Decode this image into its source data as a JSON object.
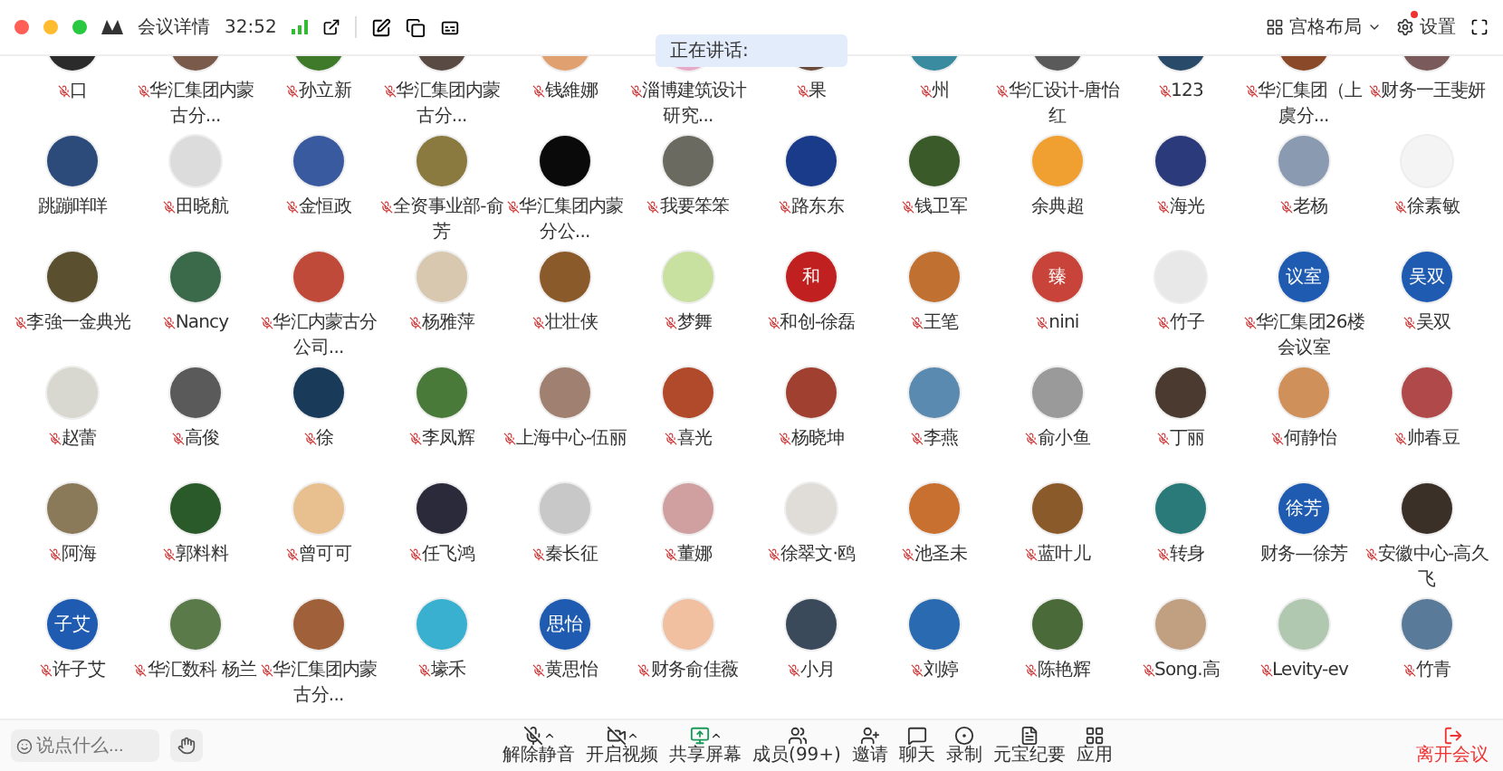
{
  "header": {
    "title": "会议详情",
    "duration": "32:52",
    "layout_label": "宫格布局",
    "settings_label": "设置",
    "settings_badge": true
  },
  "speaking": {
    "label": "正在讲话:"
  },
  "participants": [
    {
      "name": "口",
      "muted": true,
      "avatar": {
        "kind": "photo",
        "color": "#2b2b2b"
      }
    },
    {
      "name": "华汇集团内蒙古分...",
      "muted": true,
      "avatar": {
        "kind": "photo",
        "color": "#7a5a4a"
      }
    },
    {
      "name": "孙立新",
      "muted": true,
      "avatar": {
        "kind": "photo",
        "color": "#3f7a2a"
      }
    },
    {
      "name": "华汇集团内蒙古分...",
      "muted": true,
      "avatar": {
        "kind": "photo",
        "color": "#5a4a44"
      }
    },
    {
      "name": "钱維娜",
      "muted": true,
      "avatar": {
        "kind": "photo",
        "color": "#e0a070"
      }
    },
    {
      "name": "淄博建筑设计研究...",
      "muted": true,
      "avatar": {
        "kind": "photo",
        "color": "#e8a8c8"
      }
    },
    {
      "name": "果",
      "muted": true,
      "avatar": {
        "kind": "photo",
        "color": "#6a4a3a"
      }
    },
    {
      "name": "州",
      "muted": true,
      "avatar": {
        "kind": "photo",
        "color": "#3a8aa0"
      }
    },
    {
      "name": "华汇设计-唐怡红",
      "muted": true,
      "avatar": {
        "kind": "photo",
        "color": "#5a5a5a"
      }
    },
    {
      "name": "123",
      "muted": true,
      "avatar": {
        "kind": "photo",
        "color": "#2a4a6a"
      }
    },
    {
      "name": "华汇集团（上虞分...",
      "muted": true,
      "avatar": {
        "kind": "photo",
        "color": "#8a4a2a"
      }
    },
    {
      "name": "财务一王斐妍",
      "muted": true,
      "avatar": {
        "kind": "photo",
        "color": "#7a5a5a"
      }
    },
    {
      "name": "跳蹦咩咩",
      "muted": false,
      "avatar": {
        "kind": "photo",
        "color": "#2c4a7a"
      }
    },
    {
      "name": "田晓航",
      "muted": true,
      "avatar": {
        "kind": "photo",
        "color": "#dcdcdc"
      }
    },
    {
      "name": "金恒政",
      "muted": true,
      "avatar": {
        "kind": "photo",
        "color": "#3a5aa0"
      }
    },
    {
      "name": "全资事业部-俞芳",
      "muted": true,
      "avatar": {
        "kind": "photo",
        "color": "#8a7a40"
      }
    },
    {
      "name": "华汇集团内蒙分公...",
      "muted": true,
      "avatar": {
        "kind": "photo",
        "color": "#0a0a0a"
      }
    },
    {
      "name": "我要笨笨",
      "muted": true,
      "avatar": {
        "kind": "photo",
        "color": "#6a6a60"
      }
    },
    {
      "name": "路东东",
      "muted": true,
      "avatar": {
        "kind": "photo",
        "color": "#1a3a8a"
      }
    },
    {
      "name": "钱卫军",
      "muted": true,
      "avatar": {
        "kind": "photo",
        "color": "#3a5a2a"
      }
    },
    {
      "name": "余典超",
      "muted": false,
      "avatar": {
        "kind": "photo",
        "color": "#f0a030"
      }
    },
    {
      "name": "海光",
      "muted": true,
      "avatar": {
        "kind": "photo",
        "color": "#2a3a7a"
      }
    },
    {
      "name": "老杨",
      "muted": true,
      "avatar": {
        "kind": "photo",
        "color": "#8a9ab0"
      }
    },
    {
      "name": "徐素敏",
      "muted": true,
      "avatar": {
        "kind": "photo",
        "color": "#f4f4f4"
      }
    },
    {
      "name": "李強一金典光",
      "muted": true,
      "avatar": {
        "kind": "photo",
        "color": "#5a5030"
      }
    },
    {
      "name": "Nancy",
      "muted": true,
      "avatar": {
        "kind": "photo",
        "color": "#3a6a4a"
      }
    },
    {
      "name": "华汇内蒙古分公司...",
      "muted": true,
      "avatar": {
        "kind": "photo",
        "color": "#c04a3a"
      }
    },
    {
      "name": "杨雅萍",
      "muted": true,
      "avatar": {
        "kind": "photo",
        "color": "#d8c8b0"
      }
    },
    {
      "name": "壮壮侠",
      "muted": true,
      "avatar": {
        "kind": "photo",
        "color": "#8a5a2a"
      }
    },
    {
      "name": "梦舞",
      "muted": true,
      "avatar": {
        "kind": "photo",
        "color": "#c8e0a0"
      }
    },
    {
      "name": "和创-徐磊",
      "muted": true,
      "avatar": {
        "kind": "text",
        "text": "和",
        "color": "#c02020"
      }
    },
    {
      "name": "王笔",
      "muted": true,
      "avatar": {
        "kind": "photo",
        "color": "#c07030"
      }
    },
    {
      "name": "nini",
      "muted": true,
      "avatar": {
        "kind": "text",
        "text": "臻",
        "color": "#c8443a"
      }
    },
    {
      "name": "竹子",
      "muted": true,
      "avatar": {
        "kind": "photo",
        "color": "#e8e8e8"
      }
    },
    {
      "name": "华汇集团26楼会议室",
      "muted": true,
      "avatar": {
        "kind": "text",
        "text": "议室",
        "color": "#1f5bb0"
      }
    },
    {
      "name": "吴双",
      "muted": true,
      "avatar": {
        "kind": "text",
        "text": "吴双",
        "color": "#1f5bb0"
      }
    },
    {
      "name": "赵蕾",
      "muted": true,
      "avatar": {
        "kind": "photo",
        "color": "#d8d8d0"
      }
    },
    {
      "name": "高俊",
      "muted": true,
      "avatar": {
        "kind": "photo",
        "color": "#5a5a5a"
      }
    },
    {
      "name": "徐",
      "muted": true,
      "avatar": {
        "kind": "photo",
        "color": "#1a3a5a"
      }
    },
    {
      "name": "李凤辉",
      "muted": true,
      "avatar": {
        "kind": "photo",
        "color": "#4a7a3a"
      }
    },
    {
      "name": "上海中心-伍丽",
      "muted": true,
      "avatar": {
        "kind": "photo",
        "color": "#a08070"
      }
    },
    {
      "name": "喜光",
      "muted": true,
      "avatar": {
        "kind": "photo",
        "color": "#b04a2a"
      }
    },
    {
      "name": "杨晓坤",
      "muted": true,
      "avatar": {
        "kind": "photo",
        "color": "#a04030"
      }
    },
    {
      "name": "李燕",
      "muted": true,
      "avatar": {
        "kind": "photo",
        "color": "#5a8ab0"
      }
    },
    {
      "name": "俞小鱼",
      "muted": true,
      "avatar": {
        "kind": "photo",
        "color": "#9a9a9a"
      }
    },
    {
      "name": "丁丽",
      "muted": true,
      "avatar": {
        "kind": "photo",
        "color": "#4a3a30"
      }
    },
    {
      "name": "何静怡",
      "muted": true,
      "avatar": {
        "kind": "photo",
        "color": "#d0905a"
      }
    },
    {
      "name": "帅春豆",
      "muted": true,
      "avatar": {
        "kind": "photo",
        "color": "#b04a4a"
      }
    },
    {
      "name": "阿海",
      "muted": true,
      "avatar": {
        "kind": "photo",
        "color": "#8a7a5a"
      }
    },
    {
      "name": "郭料料",
      "muted": true,
      "avatar": {
        "kind": "photo",
        "color": "#2a5a2a"
      }
    },
    {
      "name": "曾可可",
      "muted": true,
      "avatar": {
        "kind": "photo",
        "color": "#e8c090"
      }
    },
    {
      "name": "任飞鸿",
      "muted": true,
      "avatar": {
        "kind": "photo",
        "color": "#2a2a3a"
      }
    },
    {
      "name": "秦长征",
      "muted": true,
      "avatar": {
        "kind": "photo",
        "color": "#c8c8c8"
      }
    },
    {
      "name": "董娜",
      "muted": true,
      "avatar": {
        "kind": "photo",
        "color": "#d0a0a0"
      }
    },
    {
      "name": "徐翠文·鸥",
      "muted": true,
      "avatar": {
        "kind": "photo",
        "color": "#e0dcd8"
      }
    },
    {
      "name": "池圣未",
      "muted": true,
      "avatar": {
        "kind": "photo",
        "color": "#c87030"
      }
    },
    {
      "name": "蓝叶儿",
      "muted": true,
      "avatar": {
        "kind": "photo",
        "color": "#8a5a2a"
      }
    },
    {
      "name": "转身",
      "muted": true,
      "avatar": {
        "kind": "photo",
        "color": "#2a7a7a"
      }
    },
    {
      "name": "财务—徐芳",
      "muted": false,
      "avatar": {
        "kind": "text",
        "text": "徐芳",
        "color": "#1f5bb0"
      }
    },
    {
      "name": "安徽中心-高久飞",
      "muted": true,
      "avatar": {
        "kind": "photo",
        "color": "#3a3028"
      }
    },
    {
      "name": "许子艾",
      "muted": true,
      "avatar": {
        "kind": "text",
        "text": "子艾",
        "color": "#1f5bb0"
      }
    },
    {
      "name": "华汇数科 杨兰",
      "muted": true,
      "avatar": {
        "kind": "photo",
        "color": "#5a7a4a"
      }
    },
    {
      "name": "华汇集团内蒙古分...",
      "muted": true,
      "avatar": {
        "kind": "photo",
        "color": "#a0603a"
      }
    },
    {
      "name": "壕禾",
      "muted": true,
      "avatar": {
        "kind": "photo",
        "color": "#3ab0d0"
      }
    },
    {
      "name": "黄思怡",
      "muted": true,
      "avatar": {
        "kind": "text",
        "text": "思怡",
        "color": "#1f5bb0"
      }
    },
    {
      "name": "财务俞佳薇",
      "muted": true,
      "avatar": {
        "kind": "photo",
        "color": "#f0c0a0"
      }
    },
    {
      "name": "小月",
      "muted": true,
      "avatar": {
        "kind": "photo",
        "color": "#3a4a5a"
      }
    },
    {
      "name": "刘婷",
      "muted": true,
      "avatar": {
        "kind": "photo",
        "color": "#2a6ab0"
      }
    },
    {
      "name": "陈艳辉",
      "muted": true,
      "avatar": {
        "kind": "photo",
        "color": "#4a6a3a"
      }
    },
    {
      "name": "Song.高",
      "muted": true,
      "avatar": {
        "kind": "photo",
        "color": "#c0a080"
      }
    },
    {
      "name": "Levity-ev",
      "muted": true,
      "avatar": {
        "kind": "photo",
        "color": "#b0c8b0"
      }
    },
    {
      "name": "竹青",
      "muted": true,
      "avatar": {
        "kind": "photo",
        "color": "#5a7a9a"
      }
    }
  ],
  "chat_input": {
    "placeholder": "说点什么..."
  },
  "toolbar": [
    {
      "kind": "mic",
      "label": "解除静音",
      "menu": true
    },
    {
      "kind": "video",
      "label": "开启视频",
      "menu": true
    },
    {
      "kind": "share",
      "label": "共享屏幕",
      "menu": true
    },
    {
      "kind": "members",
      "label": "成员(99+)",
      "menu": false
    },
    {
      "kind": "invite",
      "label": "邀请",
      "menu": false
    },
    {
      "kind": "chat",
      "label": "聊天",
      "menu": false
    },
    {
      "kind": "record",
      "label": "录制",
      "menu": false
    },
    {
      "kind": "notes",
      "label": "元宝纪要",
      "menu": false
    },
    {
      "kind": "apps",
      "label": "应用",
      "menu": false
    }
  ],
  "leave": {
    "label": "离开会议"
  }
}
